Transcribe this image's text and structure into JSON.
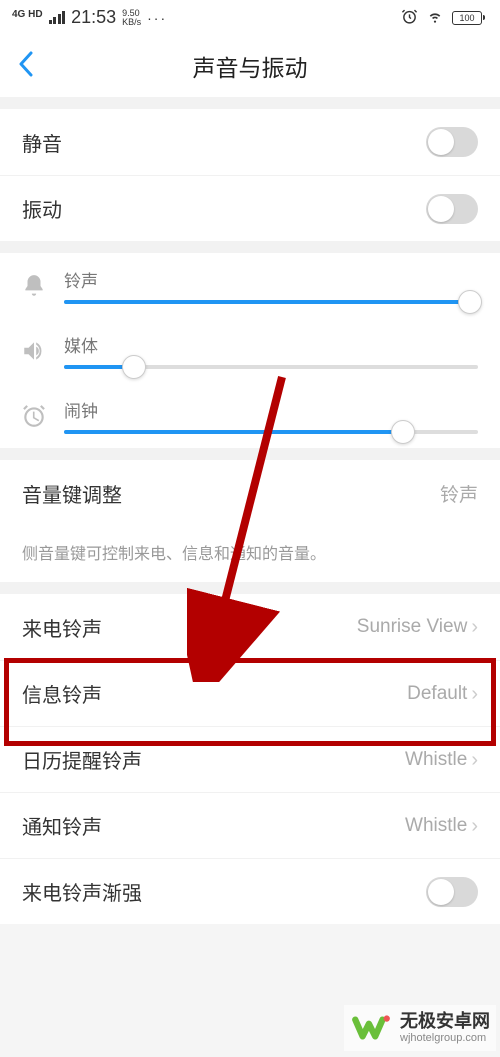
{
  "statusbar": {
    "net_label": "4G HD",
    "time": "21:53",
    "speed_value": "9.50",
    "speed_unit": "KB/s",
    "dots": "···",
    "battery": "100"
  },
  "header": {
    "title": "声音与振动"
  },
  "toggles": {
    "mute_label": "静音",
    "vibrate_label": "振动"
  },
  "sliders": {
    "ringtone": {
      "label": "铃声",
      "percent": 98
    },
    "media": {
      "label": "媒体",
      "percent": 17
    },
    "alarm": {
      "label": "闹钟",
      "percent": 82
    }
  },
  "volume_key": {
    "label": "音量键调整",
    "value": "铃声",
    "desc": "侧音量键可控制来电、信息和通知的音量。"
  },
  "ringtones": {
    "incoming": {
      "label": "来电铃声",
      "value": "Sunrise View"
    },
    "message": {
      "label": "信息铃声",
      "value": "Default"
    },
    "calendar": {
      "label": "日历提醒铃声",
      "value": "Whistle"
    },
    "notification": {
      "label": "通知铃声",
      "value": "Whistle"
    },
    "crescendo": {
      "label": "来电铃声渐强"
    }
  },
  "watermark": {
    "cn": "无极安卓网",
    "en": "wjhotelgroup.com"
  }
}
